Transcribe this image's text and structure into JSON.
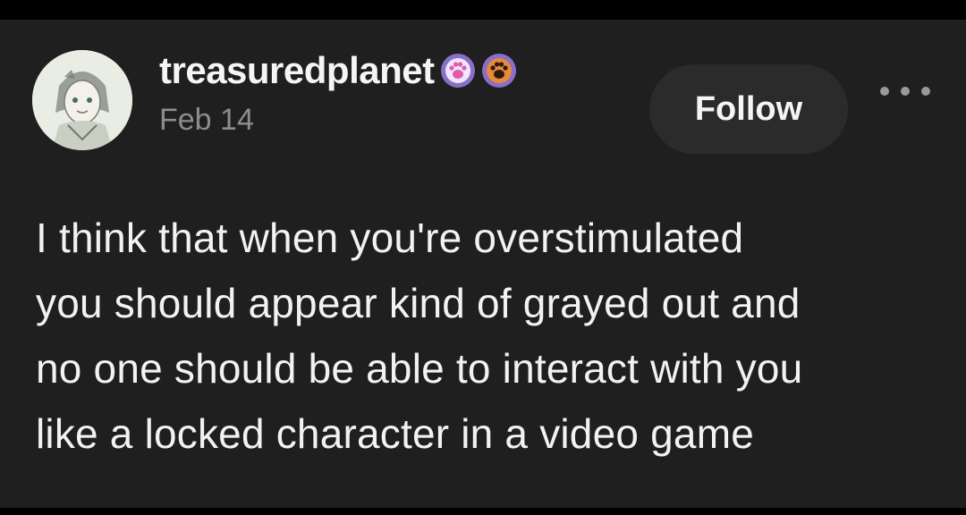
{
  "post": {
    "author": {
      "username": "treasuredplanet",
      "avatar_icon": "avatar-image",
      "badges": [
        {
          "icon": "paw-badge-pink-icon",
          "color": "#e25aa8"
        },
        {
          "icon": "paw-badge-orange-icon",
          "color": "#e88a3a"
        }
      ]
    },
    "date": "Feb 14",
    "follow_label": "Follow",
    "more_icon": "more-options-icon",
    "body_lines": [
      "I think that when you're overstimulated",
      "you should appear kind of grayed out and",
      "no one should be able to interact with you",
      "like a locked character in a video game"
    ]
  },
  "colors": {
    "background": "#1f1f1f",
    "outer": "#000000",
    "follow_button": "#2b2b2b",
    "muted_text": "#8d8d8d"
  }
}
